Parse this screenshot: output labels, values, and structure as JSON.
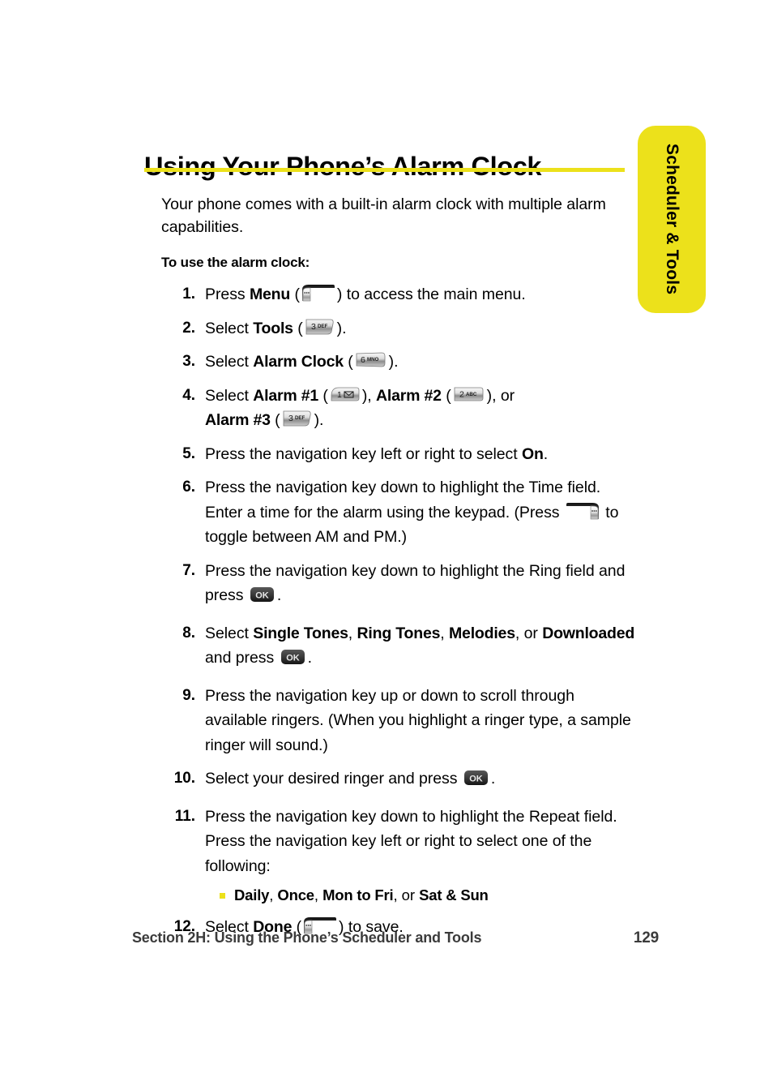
{
  "side_tab": {
    "label": "Scheduler & Tools",
    "color": "#ece11b"
  },
  "heading": {
    "title": "Using Your Phone’s Alarm Clock",
    "rule_color": "#ece11b"
  },
  "intro": "Your phone comes with a built-in alarm clock with multiple alarm capabilities.",
  "lead_in": "To use the alarm clock:",
  "steps": [
    {
      "num": "1.",
      "text_before": "Press ",
      "bold1": "Menu",
      "text_mid": " (",
      "icon": "softkey-left-icon",
      "text_after": ") to access the main menu."
    },
    {
      "num": "2.",
      "text_before": "Select ",
      "bold1": "Tools",
      "text_mid": " (",
      "icon": "key-3-def-icon",
      "text_after": ")."
    },
    {
      "num": "3.",
      "text_before": "Select ",
      "bold1": "Alarm Clock",
      "text_mid": " (",
      "icon": "key-6-mno-icon",
      "text_after": ")."
    },
    {
      "num": "4.",
      "text_before": "Select ",
      "bold1": "Alarm #1",
      "text_mid": " (",
      "icon": "key-1-envelope-icon",
      "text_after": "), ",
      "bold2": "Alarm #2",
      "text_mid2": " (",
      "icon2": "key-2-abc-icon",
      "text_after2": "), or ",
      "bold3": "Alarm #3",
      "text_mid3": " (",
      "icon3": "key-3-def-icon",
      "text_after3": ")."
    },
    {
      "num": "5.",
      "text_before": "Press the navigation key left or right to select ",
      "bold1": "On",
      "text_after": "."
    },
    {
      "num": "6.",
      "text_before": "Press the navigation key down to highlight the Time field. Enter a time for the alarm using the keypad. (Press ",
      "icon": "softkey-right-icon",
      "text_after": " to toggle between AM and PM.)"
    },
    {
      "num": "7.",
      "text_before": "Press the navigation key down to highlight the Ring field and press ",
      "icon": "ok-key-icon",
      "text_after": "."
    },
    {
      "num": "8.",
      "text_before": "Select ",
      "bold1": "Single Tones",
      "text_mid": ", ",
      "bold2": "Ring Tones",
      "text_mid2": ", ",
      "bold3": "Melodies",
      "text_mid3": ", or ",
      "bold4": "Downloaded",
      "text_after": " and press ",
      "icon": "ok-key-icon",
      "text_end": "."
    },
    {
      "num": "9.",
      "text_before": "Press the navigation key up or down to scroll through available ringers. (When you highlight a ringer type, a sample ringer will sound.)"
    },
    {
      "num": "10.",
      "text_before": "Select your desired ringer and press ",
      "icon": "ok-key-icon",
      "text_after": "."
    },
    {
      "num": "11.",
      "text_before": "Press the navigation key down to highlight the Repeat field. Press the navigation key left or right to select one of the following:",
      "sub_items": [
        {
          "bold1": "Daily",
          "sep1": ", ",
          "bold2": "Once",
          "sep2": ", ",
          "bold3": "Mon to Fri",
          "sep3": ", or ",
          "bold4": "Sat & Sun"
        }
      ]
    },
    {
      "num": "12.",
      "text_before": "Select ",
      "bold1": "Done",
      "text_mid": " (",
      "icon": "softkey-left-icon",
      "text_after": ") to save."
    }
  ],
  "key_icons": {
    "key_3": {
      "digit": "3",
      "letters": "DEF"
    },
    "key_6": {
      "digit": "6",
      "letters": "MNO"
    },
    "key_2": {
      "digit": "2",
      "letters": "ABC"
    },
    "key_1": {
      "digit": "1",
      "letters": "✉"
    },
    "ok": {
      "label": "OK"
    }
  },
  "footer": {
    "section": "Section 2H: Using the Phone’s Scheduler and Tools",
    "page_number": "129"
  }
}
